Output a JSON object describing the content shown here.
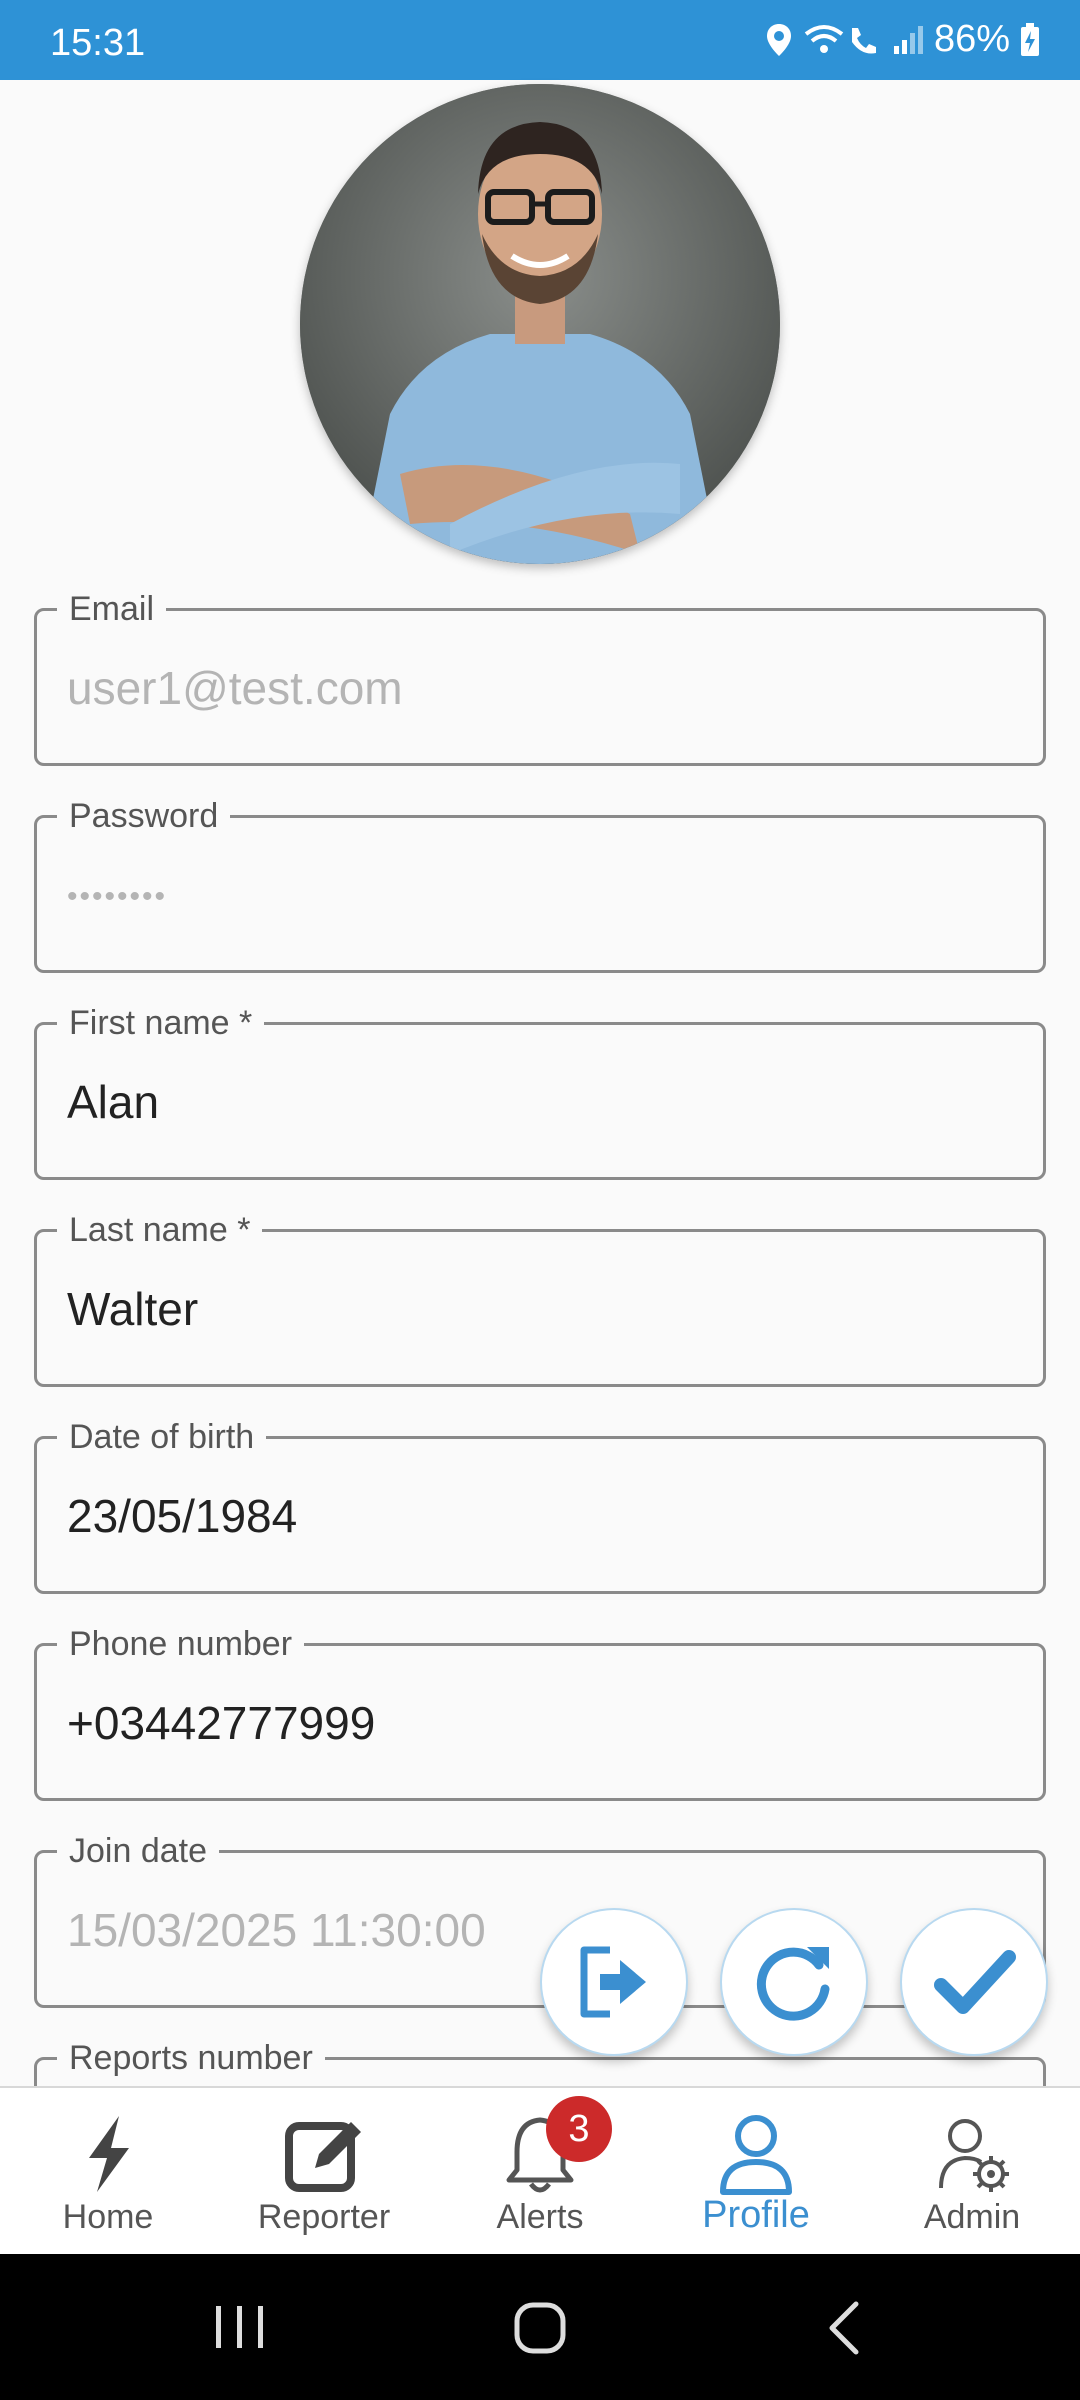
{
  "status_bar": {
    "time": "15:31",
    "battery_percent": "86%",
    "icons": [
      "location-icon",
      "wifi-calling-icon",
      "signal-icon",
      "battery-charging-icon"
    ]
  },
  "profile": {
    "avatar": "profile-photo"
  },
  "fields": [
    {
      "label": "Email",
      "value": "user1@test.com",
      "disabled": true
    },
    {
      "label": "Password",
      "value": "••••••••",
      "disabled": true
    },
    {
      "label": "First name *",
      "value": "Alan",
      "disabled": false
    },
    {
      "label": "Last name *",
      "value": "Walter",
      "disabled": false
    },
    {
      "label": "Date of birth",
      "value": "23/05/1984",
      "disabled": false
    },
    {
      "label": "Phone number",
      "value": "+03442777999",
      "disabled": false
    },
    {
      "label": "Join date",
      "value": "15/03/2025 11:30:00",
      "disabled": true
    },
    {
      "label": "Reports number",
      "value": "",
      "disabled": true
    }
  ],
  "fabs": [
    {
      "name": "logout-button",
      "icon": "logout-icon"
    },
    {
      "name": "refresh-button",
      "icon": "refresh-icon"
    },
    {
      "name": "save-button",
      "icon": "check-icon"
    }
  ],
  "bottom_nav": {
    "items": [
      {
        "label": "Home",
        "icon": "lightning-icon",
        "active": false
      },
      {
        "label": "Reporter",
        "icon": "edit-icon",
        "active": false
      },
      {
        "label": "Alerts",
        "icon": "bell-icon",
        "active": false
      },
      {
        "label": "Profile",
        "icon": "person-icon",
        "active": true
      },
      {
        "label": "Admin",
        "icon": "admin-gear-icon",
        "active": false
      }
    ],
    "alerts_badge": "3"
  },
  "colors": {
    "accent": "#2e92d6",
    "active_nav": "#3b8fd0",
    "badge": "#cc2a2a"
  }
}
